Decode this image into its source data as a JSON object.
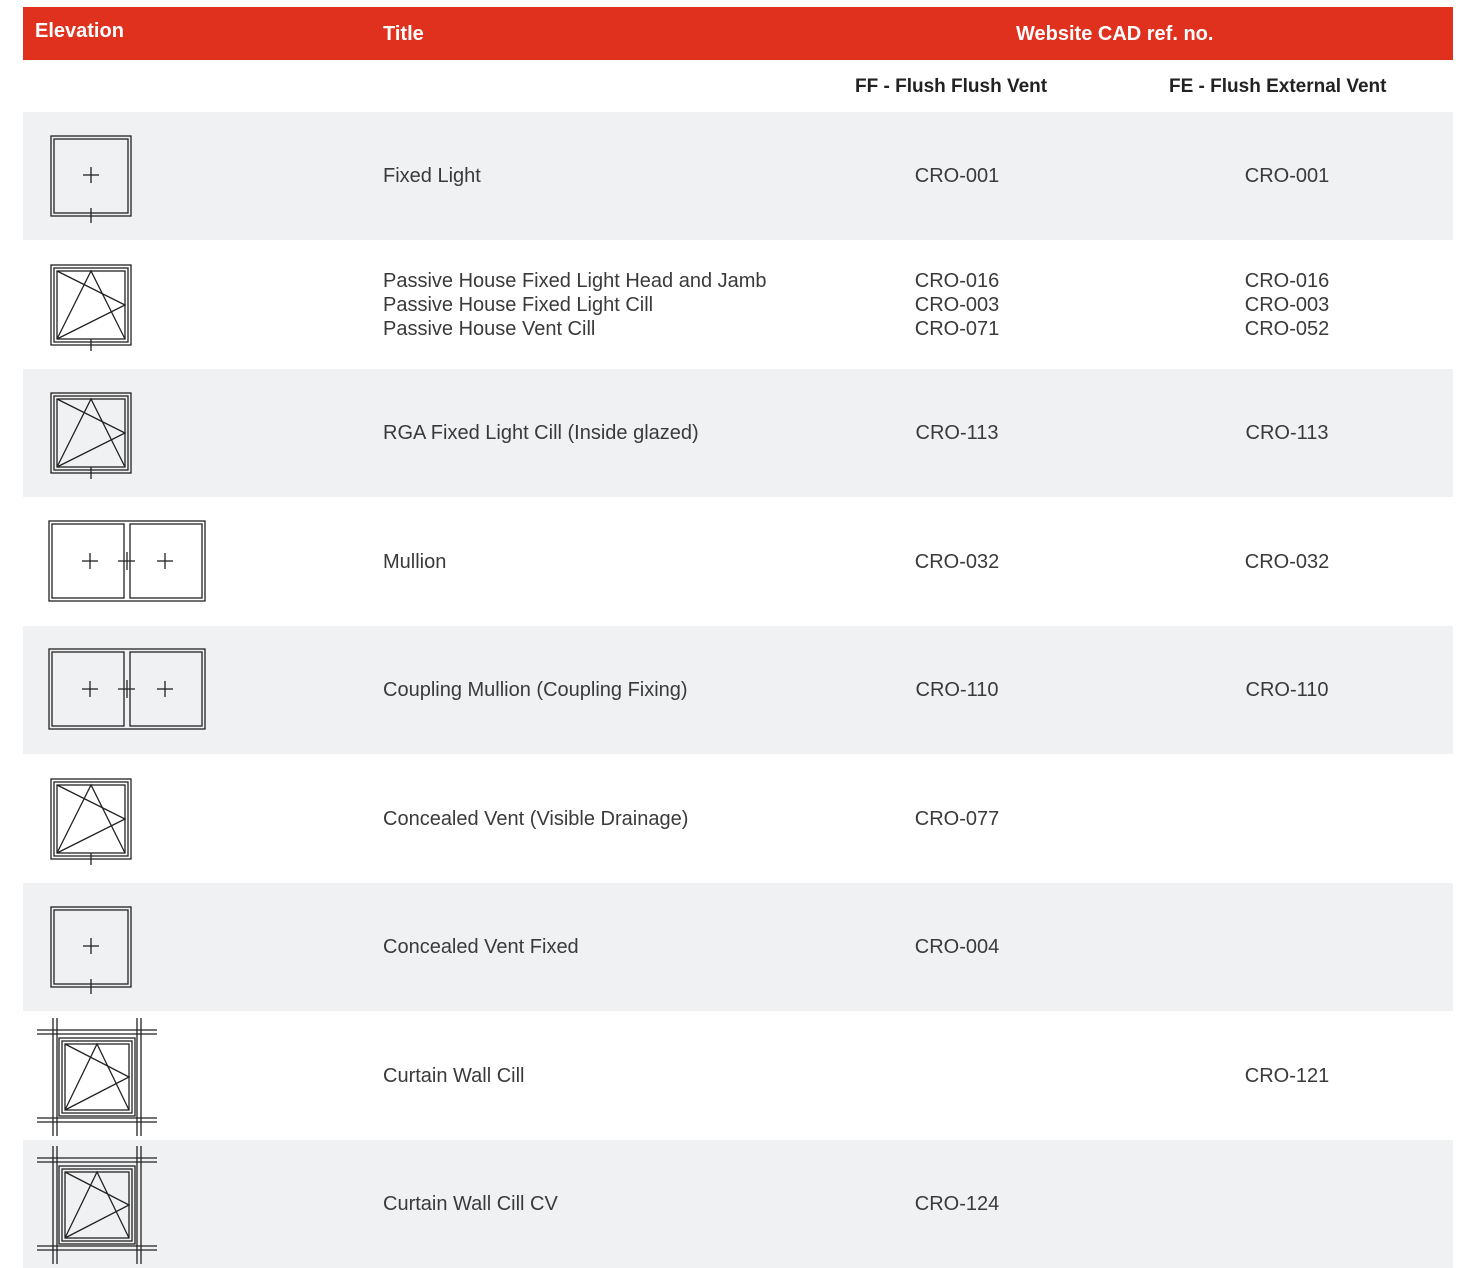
{
  "header": {
    "elevation": "Elevation",
    "title": "Title",
    "cad": "Website CAD ref. no."
  },
  "subheaders": {
    "ff": "FF - Flush Flush Vent",
    "fe": "FE - Flush External Vent"
  },
  "rows": [
    {
      "icon": "fixed-light-elevation-icon",
      "title": [
        "Fixed Light"
      ],
      "ff": [
        "CRO-001"
      ],
      "fe": [
        "CRO-001"
      ]
    },
    {
      "icon": "vent-elevation-icon",
      "title": [
        "Passive House Fixed Light Head and Jamb",
        "Passive House Fixed Light Cill",
        "Passive House Vent Cill"
      ],
      "ff": [
        "CRO-016",
        "CRO-003",
        "CRO-071"
      ],
      "fe": [
        "CRO-016",
        "CRO-003",
        "CRO-052"
      ]
    },
    {
      "icon": "vent-elevation-icon",
      "title": [
        "RGA Fixed Light Cill (Inside glazed)"
      ],
      "ff": [
        "CRO-113"
      ],
      "fe": [
        "CRO-113"
      ]
    },
    {
      "icon": "mullion-elevation-icon",
      "title": [
        "Mullion"
      ],
      "ff": [
        "CRO-032"
      ],
      "fe": [
        "CRO-032"
      ]
    },
    {
      "icon": "coupling-mullion-elevation-icon",
      "title": [
        "Coupling Mullion (Coupling Fixing)"
      ],
      "ff": [
        "CRO-110"
      ],
      "fe": [
        "CRO-110"
      ]
    },
    {
      "icon": "vent-elevation-icon",
      "title": [
        "Concealed Vent (Visible Drainage)"
      ],
      "ff": [
        "CRO-077"
      ],
      "fe": []
    },
    {
      "icon": "fixed-light-elevation-icon",
      "title": [
        "Concealed Vent Fixed"
      ],
      "ff": [
        "CRO-004"
      ],
      "fe": []
    },
    {
      "icon": "curtain-wall-elevation-icon",
      "title": [
        "Curtain Wall Cill"
      ],
      "ff": [],
      "fe": [
        "CRO-121"
      ]
    },
    {
      "icon": "curtain-wall-elevation-icon",
      "title": [
        "Curtain Wall Cill CV"
      ],
      "ff": [
        "CRO-124"
      ],
      "fe": []
    }
  ]
}
